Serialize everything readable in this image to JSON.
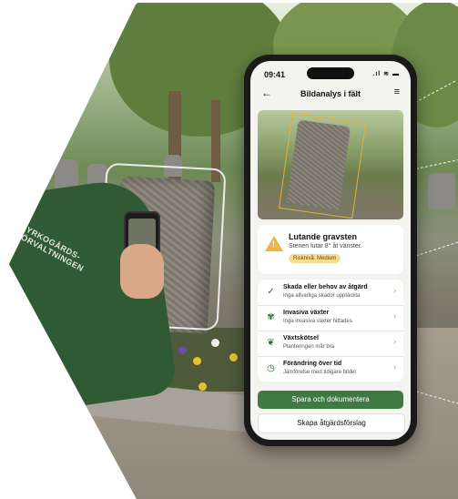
{
  "background": {
    "sleeve_logo_text": "KYRKOGÅRDS-\nFÖRVALTNINGEN",
    "colors": {
      "jacket": "#2f5a33",
      "brand_green": "#3f7a45",
      "warning": "#f0b43c"
    }
  },
  "phone": {
    "status": {
      "time": "09:41",
      "system_icons": "signal-wifi-battery"
    },
    "nav": {
      "back_icon": "arrow-left-icon",
      "title": "Bildanalys i fält",
      "menu_icon": "hamburger-menu-icon"
    },
    "alert": {
      "icon": "warning-triangle-icon",
      "title": "Lutande gravsten",
      "subtitle": "Stenen lutar 8° åt vänster.",
      "risk_badge": "Risknivå: Medium"
    },
    "checks": [
      {
        "icon": "check-circle-icon",
        "title": "Skada eller behov av åtgärd",
        "subtitle": "Inga allvarliga skador upptäckta"
      },
      {
        "icon": "plant-icon",
        "title": "Invasiva växter",
        "subtitle": "Inga invasiva växter hittades"
      },
      {
        "icon": "leaf-icon",
        "title": "Växtskötsel",
        "subtitle": "Planteringen mår bra"
      },
      {
        "icon": "clock-icon",
        "title": "Förändring över tid",
        "subtitle": "Jämförelse med tidigare bilder"
      }
    ],
    "primary_button": "Spara och dokumentera",
    "secondary_button": "Skapa åtgärdsförslag"
  }
}
